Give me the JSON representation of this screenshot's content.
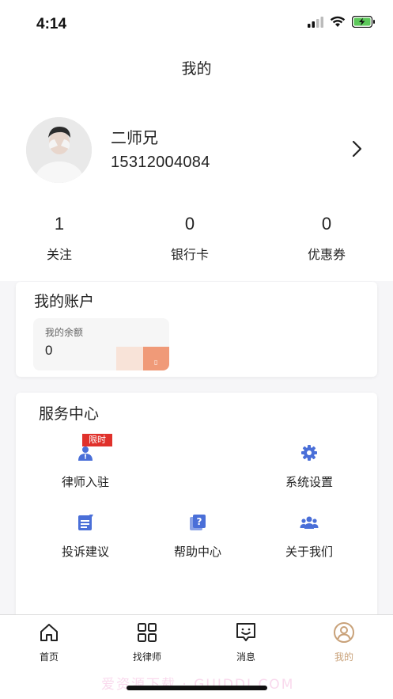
{
  "status_bar": {
    "time": "4:14"
  },
  "header": {
    "title": "我的"
  },
  "profile": {
    "name": "二师兄",
    "phone": "15312004084"
  },
  "stats": [
    {
      "value": "1",
      "label": "关注"
    },
    {
      "value": "0",
      "label": "银行卡"
    },
    {
      "value": "0",
      "label": "优惠券"
    }
  ],
  "account": {
    "title": "我的账户",
    "balance_label": "我的余额",
    "balance_value": "0"
  },
  "service": {
    "title": "服务中心",
    "badge": "限时",
    "items": [
      {
        "label": "律师入驻",
        "icon": "lawyer-icon"
      },
      {
        "label": "系统设置",
        "icon": "gear-icon"
      },
      {
        "label": "投诉建议",
        "icon": "complaint-icon"
      },
      {
        "label": "帮助中心",
        "icon": "help-icon"
      },
      {
        "label": "关于我们",
        "icon": "team-icon"
      }
    ]
  },
  "tabbar": [
    {
      "label": "首页",
      "icon": "home-icon"
    },
    {
      "label": "找律师",
      "icon": "grid-icon"
    },
    {
      "label": "消息",
      "icon": "message-icon"
    },
    {
      "label": "我的",
      "icon": "user-icon"
    }
  ],
  "colors": {
    "accent_blue": "#4a6fd8",
    "tab_active": "#c9a27a",
    "badge_red": "#e0312b"
  },
  "watermark": "爱资源下载 · GUIDDI.COM"
}
